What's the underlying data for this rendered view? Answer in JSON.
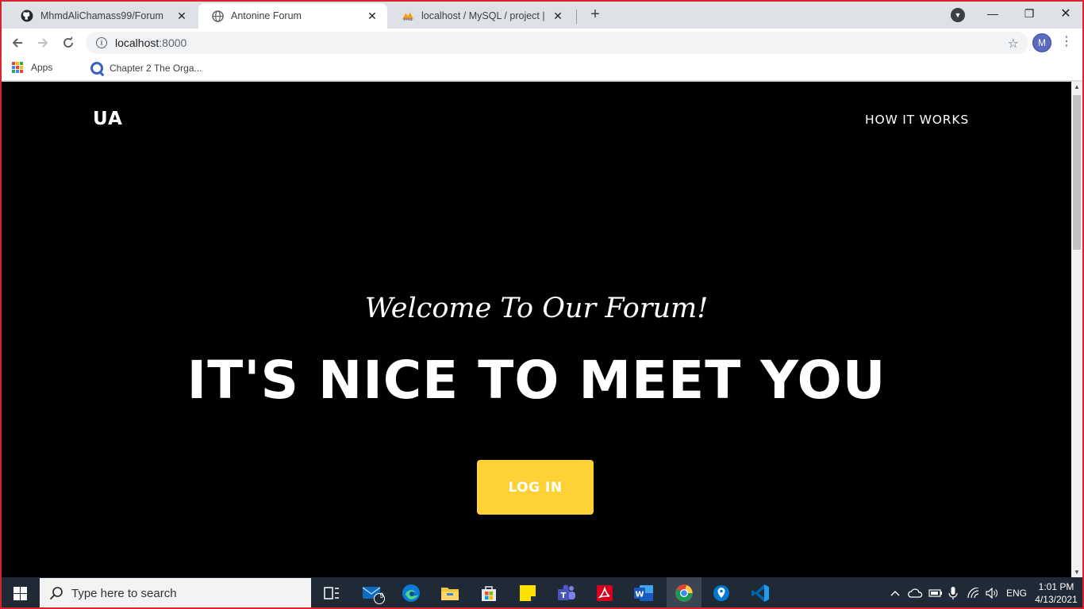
{
  "browser": {
    "tabs": [
      {
        "title": "MhmdAliChamass99/Forum",
        "icon": "github-icon",
        "active": false
      },
      {
        "title": "Antonine Forum",
        "icon": "globe-icon",
        "active": true
      },
      {
        "title": "localhost / MySQL / project | php",
        "icon": "phpmyadmin-icon",
        "active": false
      }
    ],
    "url_host": "localhost",
    "url_port": ":8000",
    "avatar_letter": "M",
    "bookmarks": [
      {
        "label": "Apps"
      },
      {
        "label": "Chapter 2 The Orga..."
      }
    ]
  },
  "page": {
    "brand": "UA",
    "nav_link": "HOW IT WORKS",
    "welcome": "Welcome To Our Forum!",
    "headline": "IT'S NICE TO MEET YOU",
    "login_button": "LOG IN",
    "accent_color": "#fed136"
  },
  "taskbar": {
    "search_placeholder": "Type here to search",
    "mail_badge": "9",
    "language": "ENG",
    "time": "1:01 PM",
    "date": "4/13/2021"
  }
}
